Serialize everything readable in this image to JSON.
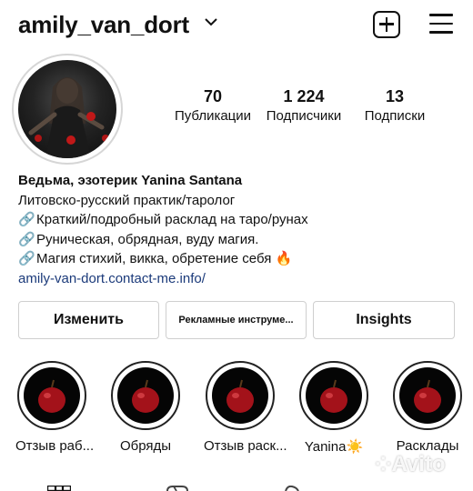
{
  "header": {
    "username": "amily_van_dort"
  },
  "stats": [
    {
      "value": "70",
      "label": "Публикации"
    },
    {
      "value": "1 224",
      "label": "Подписчики"
    },
    {
      "value": "13",
      "label": "Подписки"
    }
  ],
  "bio": {
    "name": "Ведьма, эзотерик Yanina Santana",
    "line1": "Литовско-русский практик/таролог",
    "line2": "Краткий/подробный расклад на таро/рунах",
    "line3": "Руническая, обрядная, вуду магия.",
    "line4": "Магия стихий, викка, обретение себя",
    "fire_emoji": "🔥",
    "link_emoji": "🔗",
    "link": "amily-van-dort.contact-me.info/"
  },
  "buttons": {
    "edit": "Изменить",
    "ads": "Рекламные инструме...",
    "insights": "Insights"
  },
  "highlights": [
    {
      "label": "Отзыв раб..."
    },
    {
      "label": "Обряды"
    },
    {
      "label": "Отзыв раск..."
    },
    {
      "label": "Yanina☀️"
    },
    {
      "label": "Расклады"
    }
  ],
  "watermark": "Avito",
  "icons": {
    "dropdown": "chevron-down-icon",
    "new_post": "plus-square-icon",
    "menu": "hamburger-menu-icon",
    "tab_grid": "grid-icon",
    "tab_reels": "reels-icon",
    "tab_tagged": "tagged-icon"
  }
}
